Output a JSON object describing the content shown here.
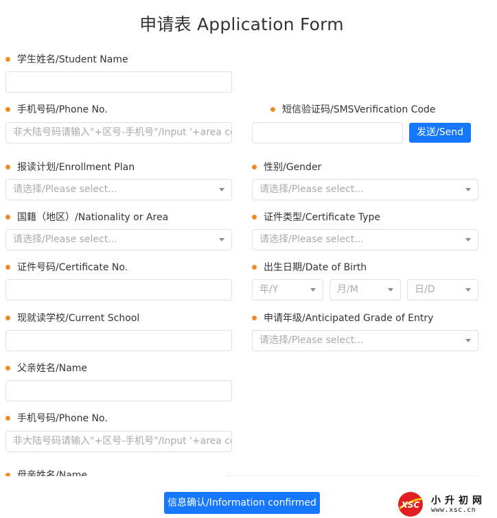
{
  "form_title": "申请表 Application Form",
  "fields": {
    "student_name": {
      "label": "学生姓名/Student Name",
      "value": ""
    },
    "phone": {
      "label": "手机号码/Phone No.",
      "placeholder": "非大陆号码请输入\"+区号-手机号\"/Input '+area co"
    },
    "sms_code": {
      "label": "短信验证码/SMSVerification Code",
      "value": "",
      "send_label": "发送/Send"
    },
    "enrollment_plan": {
      "label": "报读计划/Enrollment Plan",
      "placeholder": "请选择/Please select..."
    },
    "gender": {
      "label": "性别/Gender",
      "placeholder": "请选择/Please select..."
    },
    "nationality": {
      "label": "国籍（地区）/Nationality or Area",
      "placeholder": "请选择/Please select..."
    },
    "certificate_type": {
      "label": "证件类型/Certificate Type",
      "placeholder": "请选择/Please select..."
    },
    "certificate_no": {
      "label": "证件号码/Certificate No.",
      "value": ""
    },
    "date_of_birth": {
      "label": "出生日期/Date of Birth",
      "year": "年/Y",
      "month": "月/M",
      "day": "日/D"
    },
    "current_school": {
      "label": "现就读学校/Current School",
      "value": ""
    },
    "grade_of_entry": {
      "label": "申请年级/Anticipated Grade of Entry",
      "placeholder": "请选择/Please select..."
    },
    "father_name": {
      "label": "父亲姓名/Name",
      "value": ""
    },
    "father_phone": {
      "label": "手机号码/Phone No.",
      "placeholder": "非大陆号码请输入\"+区号-手机号\"/Input '+area co"
    },
    "mother_name": {
      "label": "母亲姓名/Name"
    }
  },
  "confirm_button": "信息确认/Information confirmed",
  "watermark": {
    "logo_text": "XSC",
    "title": "小升初网",
    "url": "www.xsc.cn",
    "colors": {
      "logo_red": "#e02020",
      "logo_yellow": "#f5c400"
    }
  },
  "colors": {
    "accent": "#1677ff",
    "bullet": "#f08a24",
    "border": "#dcdfe6",
    "placeholder": "#aaaaaa"
  }
}
